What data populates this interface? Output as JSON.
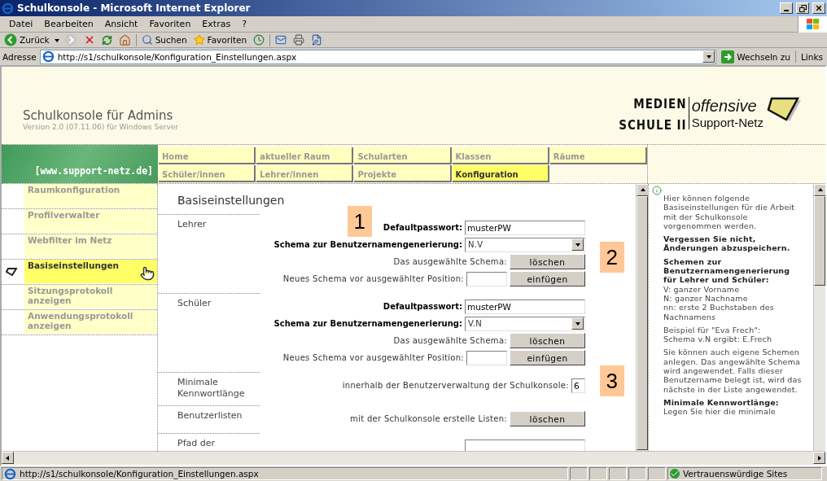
{
  "window": {
    "title": "Schulkonsole - Microsoft Internet Explorer"
  },
  "menu": [
    "Datei",
    "Bearbeiten",
    "Ansicht",
    "Favoriten",
    "Extras",
    "?"
  ],
  "toolbar": {
    "back": "Zurück",
    "search": "Suchen",
    "favorites": "Favoriten"
  },
  "address_bar": {
    "label": "Adresse",
    "url": "http://s1/schulkonsole/Konfiguration_Einstellungen.aspx",
    "go": "Wechseln zu",
    "links": "Links"
  },
  "header": {
    "title": "Schulkonsole für Admins",
    "subtitle": "Version 2.0 (07.11.06) für Windows Server",
    "logo": {
      "top_left": "MEDIEN",
      "top_right": "offensive",
      "bottom_left": "SCHULE II",
      "bottom_right": "Support-Netz"
    }
  },
  "banner": "[www.support-netz.de]",
  "tabs": [
    {
      "label": "Home",
      "selected": false
    },
    {
      "label": "aktueller Raum",
      "selected": false
    },
    {
      "label": "Schularten",
      "selected": false
    },
    {
      "label": "Klassen",
      "selected": false
    },
    {
      "label": "Räume",
      "selected": false
    },
    {
      "label": "Schüler/innen",
      "selected": false
    },
    {
      "label": "Lehrer/innen",
      "selected": false
    },
    {
      "label": "Projekte",
      "selected": false
    },
    {
      "label": "Konfiguration",
      "selected": true
    }
  ],
  "sidebar": {
    "items": [
      {
        "label": "Raumkonfiguration",
        "selected": false
      },
      {
        "label": "Profilverwalter",
        "selected": false
      },
      {
        "label": "Webfilter im Netz",
        "selected": false
      },
      {
        "label": "Basiseinstellungen",
        "selected": true
      },
      {
        "label": "Sitzungsprotokoll anzeigen",
        "selected": false
      },
      {
        "label": "Anwendungsprotokoll anzeigen",
        "selected": false
      }
    ]
  },
  "main": {
    "heading": "Basiseinstellungen",
    "sections": [
      {
        "label": "Lehrer",
        "rows": [
          {
            "kind": "input",
            "label": "Defaultpasswort:",
            "bold": true,
            "value": "musterPW",
            "badge": "1"
          },
          {
            "kind": "select",
            "label": "Schema zur Benutzernamengenerierung:",
            "bold": true,
            "value": "N.V"
          },
          {
            "kind": "button",
            "label": "Das ausgewählte Schema:",
            "bold": false,
            "button": "löschen",
            "badge": "2"
          },
          {
            "kind": "input_button",
            "label": "Neues Schema vor ausgewählter Position:",
            "bold": false,
            "button": "einfügen"
          }
        ]
      },
      {
        "label": "Schüler",
        "rows": [
          {
            "kind": "input",
            "label": "Defaultpasswort:",
            "bold": true,
            "value": "musterPW"
          },
          {
            "kind": "select",
            "label": "Schema zur Benutzernamengenerierung:",
            "bold": true,
            "value": "V.N"
          },
          {
            "kind": "button",
            "label": "Das ausgewählte Schema:",
            "bold": false,
            "button": "löschen"
          },
          {
            "kind": "input_button",
            "label": "Neues Schema vor ausgewählter Position:",
            "bold": false,
            "button": "einfügen"
          }
        ]
      },
      {
        "label": "Minimale Kennwortlänge",
        "rows": [
          {
            "kind": "small_input",
            "label": "innerhalb der Benutzerverwaltung der Schulkonsole:",
            "bold": false,
            "value": "6",
            "badge": "3"
          }
        ]
      },
      {
        "label": "Benutzerlisten",
        "rows": [
          {
            "kind": "button",
            "label": "mit der Schulkonsole erstelle Listen:",
            "bold": false,
            "button": "löschen"
          }
        ]
      },
      {
        "label": "Pfad der",
        "rows": [
          {
            "kind": "input"
          }
        ]
      }
    ]
  },
  "help": {
    "paragraphs": [
      {
        "lines": [
          {
            "text": "Hier können folgende Basiseinstellungen für die Arbeit mit der Schulkonsole vorgenommen werden.",
            "bold": false
          }
        ]
      },
      {
        "lines": [
          {
            "text": "Vergessen Sie nicht, Änderungen abzuspeichern.",
            "bold": true
          }
        ]
      },
      {
        "lines": [
          {
            "text": "Schemen zur Benutzernamengenerierung für Lehrer und Schüler:",
            "bold": true
          },
          {
            "text": "V: ganzer Vorname",
            "bold": false
          },
          {
            "text": "N: ganzer Nachname",
            "bold": false
          },
          {
            "text": "nn: erste 2 Buchstaben des Nachnamens",
            "bold": false
          }
        ]
      },
      {
        "lines": [
          {
            "text": "Beispiel für \"Eva Frech\":",
            "bold": false
          },
          {
            "text": "Schema v.N ergibt: E.Frech",
            "bold": false
          }
        ]
      },
      {
        "lines": [
          {
            "text": "Sie können auch eigene Schemen anlegen. Das angewählte Schema wird angewendet. Falls dieser Benutzername belegt ist, wird das nächste in der Liste angewendet.",
            "bold": false
          }
        ]
      },
      {
        "lines": [
          {
            "text": "Minimale Kennwortlänge:",
            "bold": true
          },
          {
            "text": "Legen Sie hier die minimale",
            "bold": false
          }
        ]
      }
    ]
  },
  "status_bar": {
    "url": "http://s1/schulkonsole/Konfiguration_Einstellungen.aspx",
    "zone": "Vertrauenswürdige Sites"
  }
}
